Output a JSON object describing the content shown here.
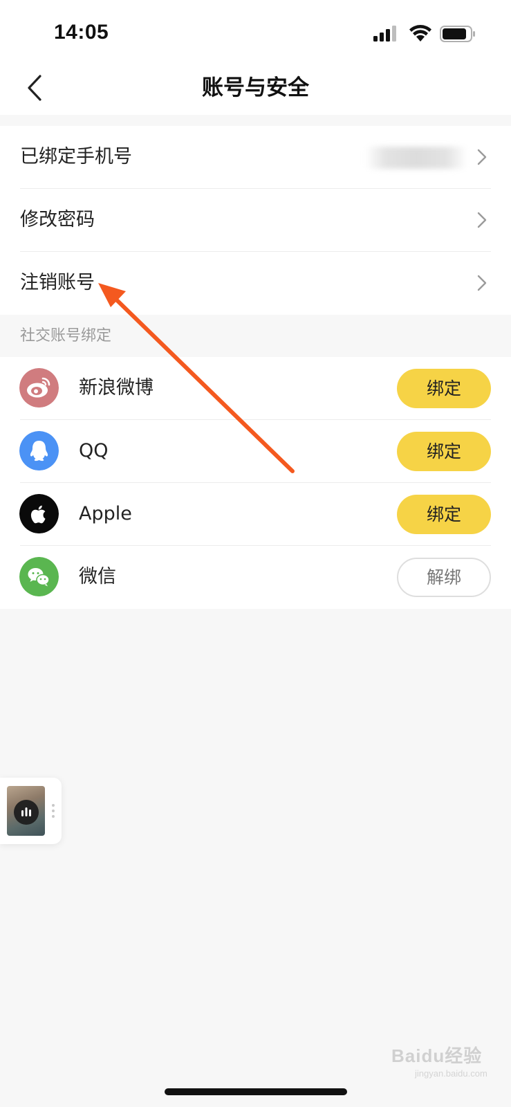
{
  "status_bar": {
    "time": "14:05",
    "icons": [
      "cellular-signal-icon",
      "wifi-icon",
      "battery-icon"
    ]
  },
  "nav": {
    "title": "账号与安全",
    "back_icon": "chevron-left-icon"
  },
  "account_rows": [
    {
      "label": "已绑定手机号",
      "value_obscured": true
    },
    {
      "label": "修改密码"
    },
    {
      "label": "注销账号"
    }
  ],
  "social_section": {
    "header": "社交账号绑定",
    "items": [
      {
        "name": "新浪微博",
        "icon": "weibo-icon",
        "icon_color": "#d07c7f",
        "action": "绑定",
        "state": "unbound"
      },
      {
        "name": "QQ",
        "icon": "qq-icon",
        "icon_color": "#4b92f5",
        "action": "绑定",
        "state": "unbound"
      },
      {
        "name": "Apple",
        "icon": "apple-icon",
        "icon_color": "#0a0a0a",
        "action": "绑定",
        "state": "unbound"
      },
      {
        "name": "微信",
        "icon": "wechat-icon",
        "icon_color": "#5ab650",
        "action": "解绑",
        "state": "bound"
      }
    ]
  },
  "colors": {
    "bind_button": "#f6d346",
    "annotation_arrow": "#f4591f",
    "page_background": "#f7f7f7"
  },
  "watermark": {
    "brand": "Baidu经验",
    "sub": "jingyan.baidu.com"
  }
}
